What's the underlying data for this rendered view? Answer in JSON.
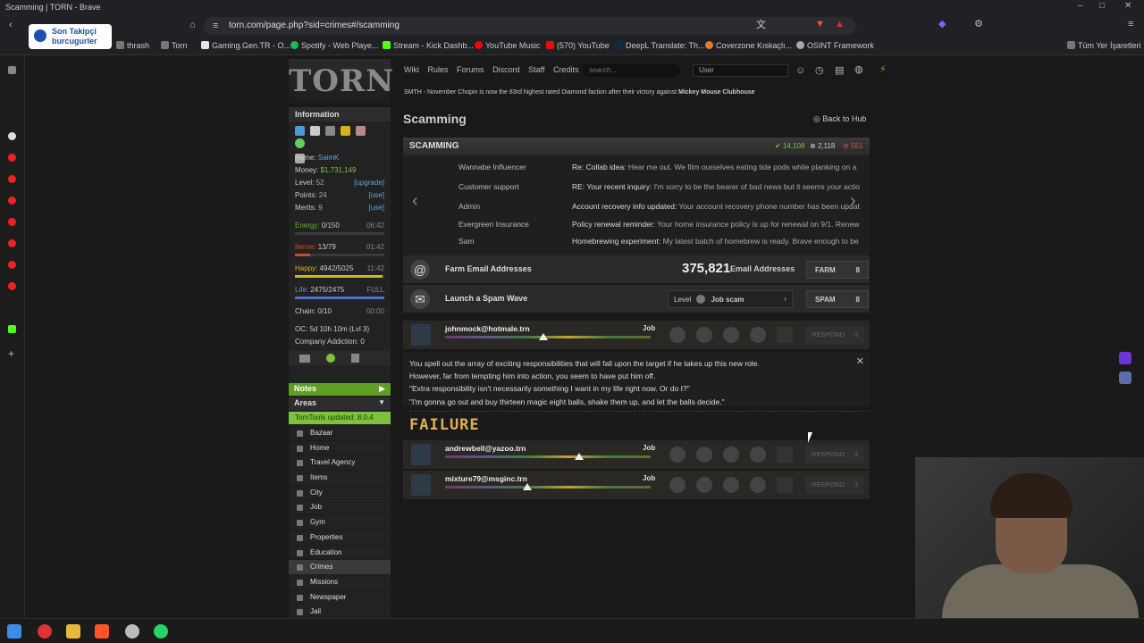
{
  "window": {
    "title": "Scamming | TORN - Brave"
  },
  "browser": {
    "url": "torn.com/page.php?sid=crimes#/scamming"
  },
  "bookmarks": [
    {
      "label": "thrash",
      "color": "#777"
    },
    {
      "label": "Torn",
      "color": "#777"
    },
    {
      "label": "Gaming.Gen.TR - O...",
      "color": "#e6e6e6"
    },
    {
      "label": "Spotify - Web Playe...",
      "color": "#1db954"
    },
    {
      "label": "Stream - Kick Dashb...",
      "color": "#53fc18"
    },
    {
      "label": "YouTube Music",
      "color": "#ff0000"
    },
    {
      "label": "(570) YouTube",
      "color": "#ff0000"
    },
    {
      "label": "DeepL Translate: Th...",
      "color": "#0f2b46"
    },
    {
      "label": "Coverzone Kıskaçlı...",
      "color": "#e07b2a"
    },
    {
      "label": "OSINT Framework",
      "color": "#aaa"
    },
    {
      "label": "Tüm Yer İşaretleri",
      "color": "#777"
    }
  ],
  "overlay": {
    "line1": "Son Takipçi",
    "line2": "burcugurler"
  },
  "site": {
    "logo": "TORN",
    "nav": [
      "Wiki",
      "Rules",
      "Forums",
      "Discord",
      "Staff",
      "Credits"
    ],
    "search_placeholder": "search...",
    "user_select": "User",
    "ticker_prefix": "SMTH - November Chopin is now the 83rd highest rated Diamond faction after their victory against",
    "ticker_bold": "Mickey Mouse Clubhouse"
  },
  "sidebar": {
    "info_title": "Information",
    "name_label": "Name:",
    "name": "SaimK",
    "money_label": "Money:",
    "money": "$1,731,149",
    "level_label": "Level:",
    "level": "52",
    "level_link": "[upgrade]",
    "points_label": "Points:",
    "points": "24",
    "points_link": "[use]",
    "merits_label": "Merits:",
    "merits": "9",
    "merits_link": "[use]",
    "energy": {
      "label": "Energy:",
      "value": "0/150",
      "time": "06:42",
      "fill": 0.0,
      "color": "#5fb52c"
    },
    "nerve": {
      "label": "Nerve:",
      "value": "13/79",
      "time": "01:42",
      "fill": 0.165,
      "color": "#d04a2a"
    },
    "happy": {
      "label": "Happy:",
      "value": "4942/5025",
      "time": "11:42",
      "fill": 0.98,
      "color": "#d8b21a"
    },
    "life": {
      "label": "Life:",
      "value": "2475/2475",
      "time": "FULL",
      "fill": 1.0,
      "color": "#4c6dd6"
    },
    "chain": {
      "label": "Chain:",
      "value": "0/10",
      "time": "00:00",
      "fill": 0.0,
      "color": "#888"
    },
    "oc": "OC: 5d 10h 10m (Lvl 3)",
    "addiction": "Company Addiction: 0",
    "notes": "Notes",
    "areas": "Areas",
    "tt_update": "TornTools updated: 8.0.4",
    "nav": [
      "Bazaar",
      "Home",
      "Travel Agency",
      "Items",
      "City",
      "Job",
      "Gym",
      "Properties",
      "Education",
      "Crimes",
      "Missions",
      "Newspaper",
      "Jail"
    ]
  },
  "page": {
    "title": "Scamming",
    "back": "Back to Hub",
    "section": "SCAMMING",
    "stat_success": "14,108",
    "stat_fail": "2,118",
    "stat_crit": "551"
  },
  "carousel": [
    {
      "name": "Wannabe Influencer",
      "subject": "Re: Collab idea:",
      "body": "Hear me out. We film ourselves eating tide pods while planking on a"
    },
    {
      "name": "Customer support",
      "subject": "RE: Your recent inquiry:",
      "body": "I'm sorry to be the bearer of bad news but it seems your actio"
    },
    {
      "name": "Admin",
      "subject": "Account recovery info updated:",
      "body": "Your account recovery phone number has been updat"
    },
    {
      "name": "Evergreen Insurance",
      "subject": "Policy renewal reminder:",
      "body": "Your home insurance policy is up for renewal on 9/1. Renew"
    },
    {
      "name": "Sam",
      "subject": "Homebrewing experiment:",
      "body": "My latest batch of homebrew is ready. Brave enough to be"
    }
  ],
  "farm": {
    "label": "Farm Email Addresses",
    "count": "375,821",
    "count_label": "Email Addresses",
    "button": "FARM",
    "cost": "8"
  },
  "spam": {
    "label": "Launch a Spam Wave",
    "level_label": "Level",
    "selected": "Job scam",
    "button": "SPAM",
    "cost": "8"
  },
  "targets": [
    {
      "email": "johnmock@hotmale.trn",
      "type": "Job",
      "respond": "RESPOND",
      "cost": "3",
      "pin": 0.48
    },
    {
      "email": "andrewbell@yazoo.trn",
      "type": "Job",
      "respond": "RESPOND",
      "cost": "3",
      "pin": 0.65
    },
    {
      "email": "mixture79@msginc.trn",
      "type": "Job",
      "respond": "RESPOND",
      "cost": "3",
      "pin": 0.4
    }
  ],
  "result_text": [
    "You spell out the array of exciting responsibilities that will fall upon the target if he takes up this new role.",
    "However, far from tempting him into action, you seem to have put him off.",
    "\"Extra responsibility isn't necessarily something I want in my life right now. Or do I?\"",
    "\"I'm gonna go out and buy thirteen magic eight balls, shake them up, and let the balls decide.\""
  ],
  "outcome": "FAILURE",
  "colors": {
    "accent_green": "#7dc23a",
    "failure": "#e0b050",
    "link": "#6aa3d6",
    "money": "#7dc23a"
  }
}
